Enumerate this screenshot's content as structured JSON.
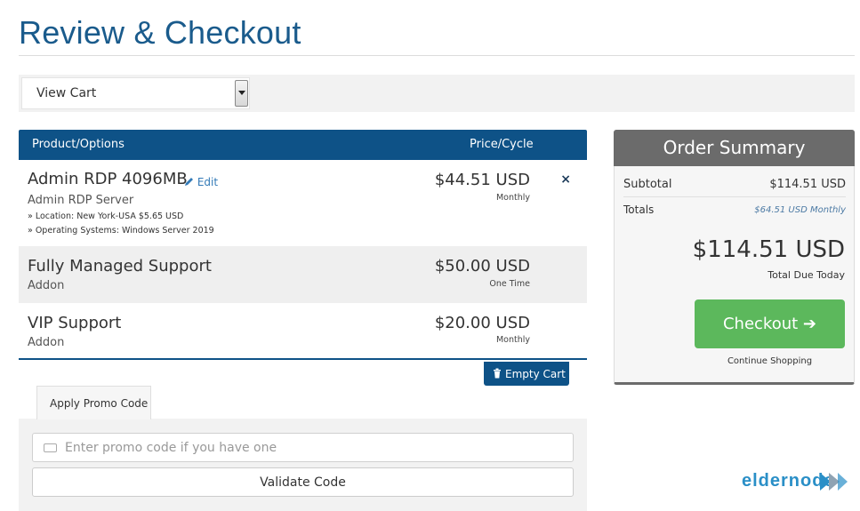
{
  "page": {
    "title": "Review & Checkout"
  },
  "view_select": {
    "selected": "View Cart"
  },
  "cart": {
    "headers": {
      "product": "Product/Options",
      "price": "Price/Cycle"
    },
    "items": [
      {
        "name": "Admin RDP 4096MB",
        "edit_label": "Edit",
        "subtitle": "Admin RDP Server",
        "options": [
          "» Location: New York-USA $5.65 USD",
          "» Operating Systems: Windows Server 2019"
        ],
        "price": "$44.51 USD",
        "cycle": "Monthly",
        "remove": "×"
      },
      {
        "name": "Fully Managed Support",
        "subtitle": "Addon",
        "price": "$50.00 USD",
        "cycle": "One Time"
      },
      {
        "name": "VIP Support",
        "subtitle": "Addon",
        "price": "$20.00 USD",
        "cycle": "Monthly"
      }
    ],
    "empty_cart_label": "Empty Cart"
  },
  "promo": {
    "tab_label": "Apply Promo Code",
    "placeholder": "Enter promo code if you have one",
    "validate_label": "Validate Code"
  },
  "summary": {
    "title": "Order Summary",
    "subtotal_label": "Subtotal",
    "subtotal_value": "$114.51 USD",
    "totals_label": "Totals",
    "totals_value": "$64.51 USD Monthly",
    "total_due": "$114.51 USD",
    "total_due_label": "Total Due Today",
    "checkout_label": "Checkout ➔",
    "continue_label": "Continue Shopping"
  },
  "brand": {
    "text": "eldernode"
  },
  "colors": {
    "primary": "#0e5287",
    "checkout": "#5cb85c",
    "summary_header": "#6b6b6b",
    "title": "#1a5b8c"
  }
}
